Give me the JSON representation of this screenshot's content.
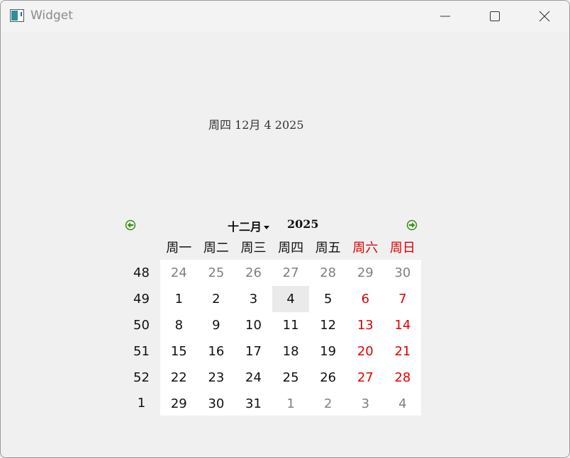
{
  "window": {
    "title": "Widget"
  },
  "date_label": "周四 12月 4 2025",
  "calendar": {
    "month": "十二月",
    "year": "2025",
    "weekday_headers": [
      "周一",
      "周二",
      "周三",
      "周四",
      "周五",
      "周六",
      "周日"
    ],
    "weeks": [
      {
        "week": "48",
        "days": [
          {
            "d": "24",
            "other": true
          },
          {
            "d": "25",
            "other": true
          },
          {
            "d": "26",
            "other": true
          },
          {
            "d": "27",
            "other": true
          },
          {
            "d": "28",
            "other": true
          },
          {
            "d": "29",
            "other": true
          },
          {
            "d": "30",
            "other": true
          }
        ]
      },
      {
        "week": "49",
        "days": [
          {
            "d": "1"
          },
          {
            "d": "2"
          },
          {
            "d": "3"
          },
          {
            "d": "4",
            "selected": true
          },
          {
            "d": "5"
          },
          {
            "d": "6"
          },
          {
            "d": "7"
          }
        ]
      },
      {
        "week": "50",
        "days": [
          {
            "d": "8"
          },
          {
            "d": "9"
          },
          {
            "d": "10"
          },
          {
            "d": "11"
          },
          {
            "d": "12"
          },
          {
            "d": "13"
          },
          {
            "d": "14"
          }
        ]
      },
      {
        "week": "51",
        "days": [
          {
            "d": "15"
          },
          {
            "d": "16"
          },
          {
            "d": "17"
          },
          {
            "d": "18"
          },
          {
            "d": "19"
          },
          {
            "d": "20"
          },
          {
            "d": "21"
          }
        ]
      },
      {
        "week": "52",
        "days": [
          {
            "d": "22"
          },
          {
            "d": "23"
          },
          {
            "d": "24"
          },
          {
            "d": "25"
          },
          {
            "d": "26"
          },
          {
            "d": "27"
          },
          {
            "d": "28"
          }
        ]
      },
      {
        "week": "1",
        "days": [
          {
            "d": "29"
          },
          {
            "d": "30"
          },
          {
            "d": "31"
          },
          {
            "d": "1",
            "other": true
          },
          {
            "d": "2",
            "other": true
          },
          {
            "d": "3",
            "other": true
          },
          {
            "d": "4",
            "other": true
          }
        ]
      }
    ]
  },
  "icons": {
    "app": "app-window-icon",
    "minimize": "minimize-icon",
    "maximize": "maximize-icon",
    "close": "close-icon",
    "prev": "arrow-left-icon",
    "next": "arrow-right-icon"
  },
  "colors": {
    "weekend": "#e00000",
    "other_month": "#808080",
    "nav_arrow": "#3f8f1f"
  }
}
